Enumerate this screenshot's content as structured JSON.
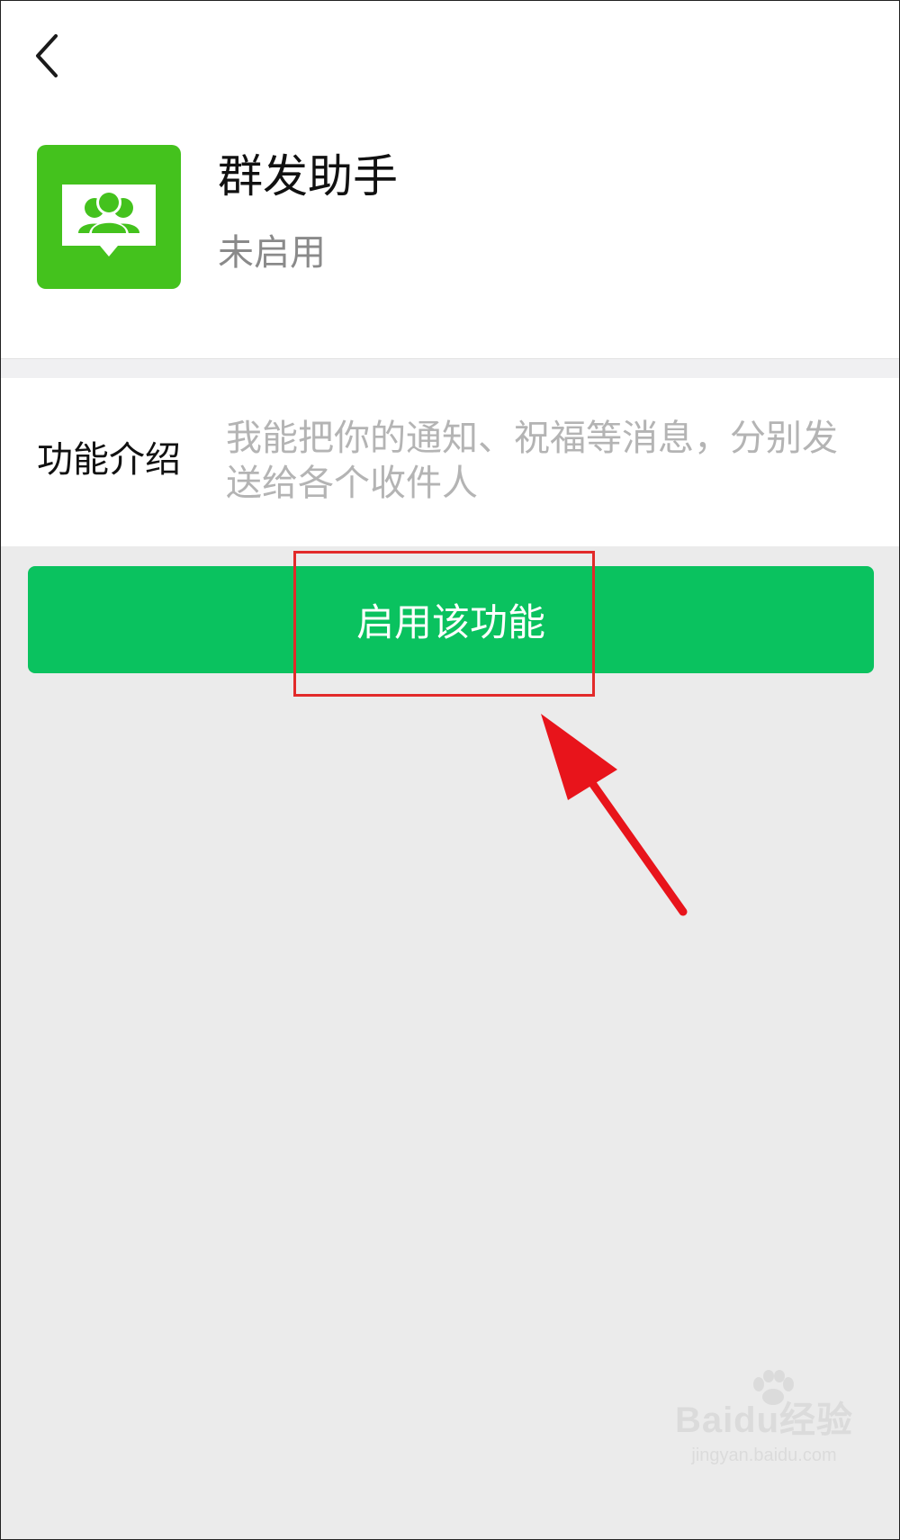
{
  "header": {
    "back_icon": "chevron-left-icon"
  },
  "app": {
    "icon": "group-broadcast-icon",
    "icon_color": "#44c21d",
    "title": "群发助手",
    "status": "未启用"
  },
  "intro": {
    "label": "功能介绍",
    "text": "我能把你的通知、祝福等消息，分别发送给各个收件人"
  },
  "action": {
    "enable_label": "启用该功能",
    "button_color": "#0ac25f"
  },
  "annotation": {
    "highlight_color": "#e22a2a",
    "arrow_icon": "red-arrow-icon"
  },
  "watermark": {
    "logo": "Baidu经验",
    "url": "jingyan.baidu.com"
  }
}
